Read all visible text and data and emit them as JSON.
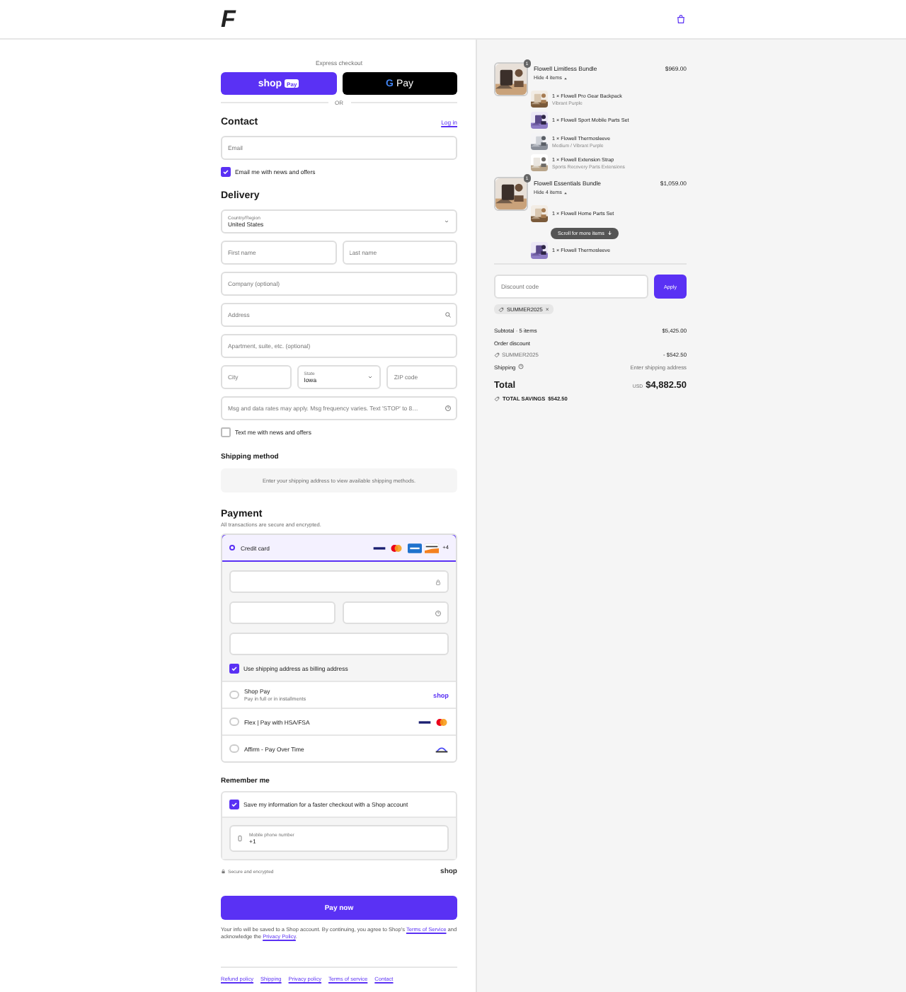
{
  "store": {
    "logo": "F"
  },
  "express_checkout": {
    "label": "Express checkout",
    "buttons": [
      {
        "kind": "shop_pay",
        "label": "shop",
        "badge": "Pay"
      },
      {
        "kind": "google_pay",
        "mark": "G",
        "label": "Pay"
      }
    ],
    "divider": "OR"
  },
  "contact": {
    "title": "Contact",
    "login": "Log in",
    "email": {
      "placeholder": "Email"
    },
    "newsletter": {
      "label": "Email me with news and offers",
      "checked": true
    }
  },
  "delivery": {
    "title": "Delivery",
    "rows": [
      [
        {
          "kind": "select",
          "label": "Country/Region",
          "value": "United States"
        }
      ],
      [
        {
          "kind": "input",
          "placeholder": "First name"
        },
        {
          "kind": "input",
          "placeholder": "Last name"
        }
      ],
      [
        {
          "kind": "input",
          "placeholder": "Company (optional)"
        }
      ],
      [
        {
          "kind": "search_input",
          "placeholder": "Address"
        }
      ],
      [
        {
          "kind": "input",
          "placeholder": "Apartment, suite, etc. (optional)"
        }
      ],
      [
        {
          "kind": "input",
          "placeholder": "City"
        },
        {
          "kind": "select",
          "label": "State",
          "value": "Iowa"
        },
        {
          "kind": "input",
          "placeholder": "ZIP code"
        }
      ],
      [
        {
          "kind": "help_input",
          "placeholder": "Msg and data rates may apply. Msg frequency varies. Text 'STOP' to 8…"
        }
      ]
    ],
    "sms_optin": {
      "label": "Text me with news and offers",
      "checked": false
    }
  },
  "shipping_method": {
    "title": "Shipping method",
    "message": "Enter your shipping address to view available shipping methods."
  },
  "payment": {
    "title": "Payment",
    "subtitle": "All transactions are secure and encrypted.",
    "methods": [
      {
        "kind": "card",
        "label": "Credit card",
        "selected": true,
        "brands": [
          {
            "kind": "visa"
          },
          {
            "kind": "mastercard"
          },
          {
            "kind": "amex"
          },
          {
            "kind": "discover"
          }
        ],
        "more": "+4",
        "billing": {
          "label": "Use shipping address as billing address",
          "checked": true
        }
      },
      {
        "kind": "shop_pay",
        "label": "Shop Pay",
        "description": "Pay in full or in installments",
        "logo": "shop",
        "selected": false
      },
      {
        "kind": "flex",
        "label": "Flex | Pay with HSA/FSA",
        "selected": false,
        "brands": [
          {
            "kind": "visa"
          },
          {
            "kind": "mastercard"
          }
        ]
      },
      {
        "kind": "affirm",
        "label": "Affirm - Pay Over Time",
        "selected": false
      }
    ]
  },
  "remember_me": {
    "title": "Remember me",
    "save": {
      "label": "Save my information for a faster checkout with a Shop account",
      "checked": true
    },
    "phone": {
      "label": "Mobile phone number",
      "value": "+1"
    },
    "secure": "Secure and encrypted",
    "logo": "shop"
  },
  "pay_button": "Pay now",
  "legal": [
    {
      "kind": "text",
      "text": "Your info will be saved to a Shop account. By continuing, you agree to Shop's "
    },
    {
      "kind": "link",
      "text": "Terms of Service"
    },
    {
      "kind": "text",
      "text": " and acknowledge the "
    },
    {
      "kind": "link",
      "text": "Privacy Policy"
    },
    {
      "kind": "text",
      "text": "."
    }
  ],
  "footer_links": [
    "Refund policy",
    "Shipping",
    "Privacy policy",
    "Terms of service",
    "Contact"
  ],
  "order_summary": {
    "bundles": [
      {
        "name": "Flowell Limitless Bundle",
        "price": "$969.00",
        "quantity": "1",
        "toggle": "Hide 4 items",
        "expanded": true,
        "items": [
          {
            "name": "1 × Flowell Pro Gear Backpack",
            "variant": "Vibrant Purple"
          },
          {
            "name": "1 × Flowell Sport Mobile Parts Set"
          },
          {
            "name": "1 × Flowell Thermosleeve",
            "variant": "Medium / Vibrant Purple"
          },
          {
            "name": "1 × Flowell Extension Strap",
            "variant": "Sports Recovery Parts Extensions"
          }
        ]
      },
      {
        "name": "Flowell Essentials Bundle",
        "price": "$1,059.00",
        "quantity": "1",
        "toggle": "Hide 4 items",
        "expanded": true,
        "items": [
          {
            "name": "1 × Flowell Home Parts Set"
          }
        ]
      }
    ],
    "scroll_hint": "Scroll for more items",
    "last_item": {
      "name": "1 × Flowell Thermosleeve"
    },
    "discount": {
      "placeholder": "Discount code",
      "button": "Apply"
    },
    "applied_code": "SUMMER2025",
    "remove": "×",
    "subtotal": {
      "label": "Subtotal · 5 items",
      "value": "$5,425.00"
    },
    "order_discount": {
      "label": "Order discount",
      "code": "SUMMER2025",
      "value": "- $542.50"
    },
    "shipping": {
      "label": "Shipping",
      "value": "Enter shipping address"
    },
    "total": {
      "label": "Total",
      "currency": "USD",
      "value": "$4,882.50"
    },
    "savings": {
      "label": "TOTAL SAVINGS",
      "value": "$542.50"
    }
  }
}
